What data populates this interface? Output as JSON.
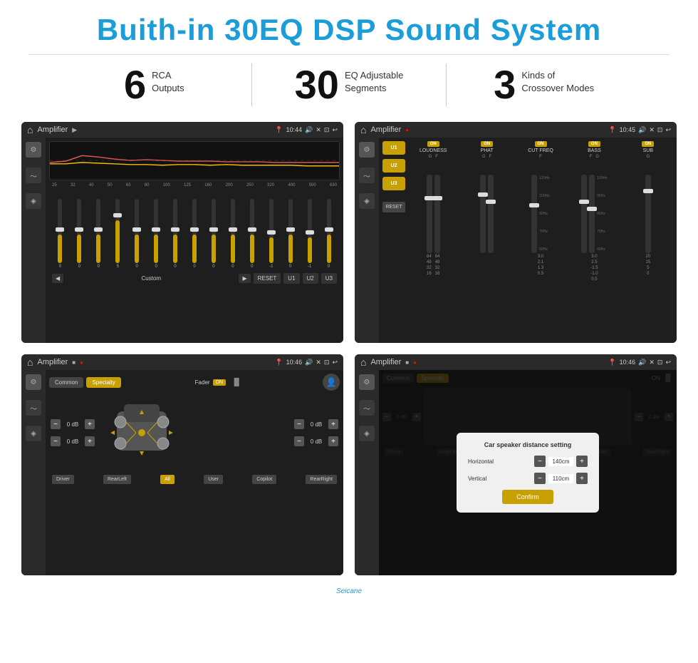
{
  "header": {
    "title": "Buith-in 30EQ DSP Sound System"
  },
  "stats": [
    {
      "number": "6",
      "label": "RCA\nOutputs"
    },
    {
      "number": "30",
      "label": "EQ Adjustable\nSegments"
    },
    {
      "number": "3",
      "label": "Kinds of\nCrossover Modes"
    }
  ],
  "screen1": {
    "title": "Amplifier",
    "time": "10:44",
    "freqs": [
      "25",
      "32",
      "40",
      "50",
      "63",
      "80",
      "100",
      "125",
      "160",
      "200",
      "250",
      "320",
      "400",
      "500",
      "630"
    ],
    "values": [
      "0",
      "0",
      "0",
      "5",
      "0",
      "0",
      "0",
      "0",
      "0",
      "0",
      "0",
      "-1",
      "0",
      "-1"
    ],
    "buttons": [
      "RESET",
      "U1",
      "U2",
      "U3"
    ],
    "preset": "Custom"
  },
  "screen2": {
    "title": "Amplifier",
    "time": "10:45",
    "channels": [
      {
        "label": "LOUDNESS",
        "sub": "G F"
      },
      {
        "label": "PHAT",
        "sub": "G F"
      },
      {
        "label": "CUT FREQ",
        "sub": "F"
      },
      {
        "label": "BASS",
        "sub": "F G"
      },
      {
        "label": "SUB",
        "sub": "G"
      }
    ],
    "uButtons": [
      "U1",
      "U2",
      "U3"
    ],
    "resetLabel": "RESET"
  },
  "screen3": {
    "title": "Amplifier",
    "time": "10:46",
    "tabs": [
      "Common",
      "Specialty"
    ],
    "activeTab": "Specialty",
    "faderLabel": "Fader",
    "faderState": "ON",
    "dbControls": [
      {
        "value": "0 dB"
      },
      {
        "value": "0 dB"
      },
      {
        "value": "0 dB"
      },
      {
        "value": "0 dB"
      }
    ],
    "positions": [
      "Driver",
      "RearLeft",
      "All",
      "User",
      "Copilot",
      "RearRight"
    ]
  },
  "screen4": {
    "title": "Amplifier",
    "time": "10:46",
    "tabs": [
      "Common",
      "Specialty"
    ],
    "dialog": {
      "title": "Car speaker distance setting",
      "horizontal": {
        "label": "Horizontal",
        "value": "140cm"
      },
      "vertical": {
        "label": "Vertical",
        "value": "110cm"
      },
      "confirmLabel": "Confirm"
    },
    "dbControls": [
      {
        "value": "0 dB"
      },
      {
        "value": "0 dB"
      }
    ],
    "positions": [
      "Driver",
      "RearLeft",
      "All",
      "User",
      "Copilot",
      "RearRight"
    ]
  },
  "watermark": "Seicane"
}
